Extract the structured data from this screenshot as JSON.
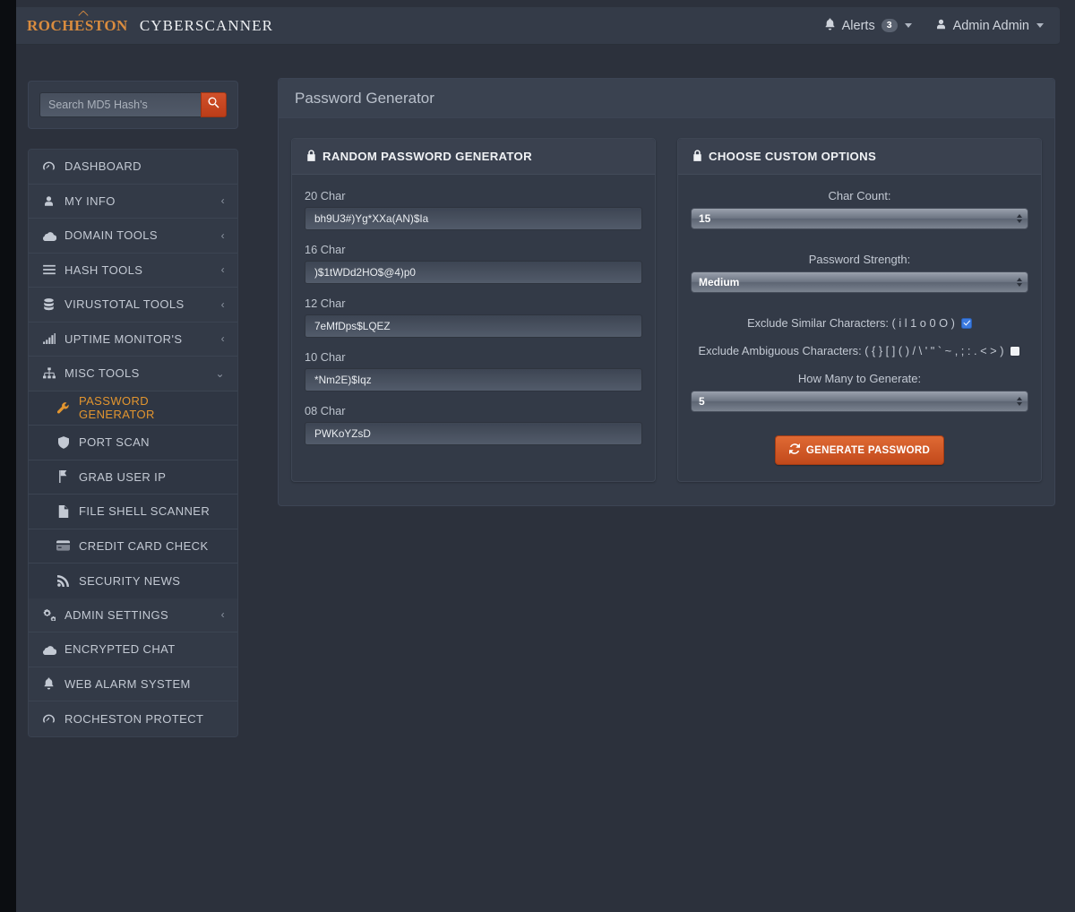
{
  "brand": {
    "primary": "ROCHESTON",
    "secondary": "CYBERSCANNER",
    "accent": "#d98c3f"
  },
  "navbar": {
    "alerts_label": "Alerts",
    "alerts_count": "3",
    "user_label": "Admin Admin"
  },
  "search": {
    "placeholder": "Search MD5 Hash's",
    "value": ""
  },
  "sidebar": {
    "items": [
      {
        "label": "DASHBOARD",
        "icon": "dashboard-icon",
        "chevron": ""
      },
      {
        "label": "MY INFO",
        "icon": "user-icon",
        "chevron": "‹"
      },
      {
        "label": "DOMAIN TOOLS",
        "icon": "cloud-icon",
        "chevron": "‹"
      },
      {
        "label": "HASH TOOLS",
        "icon": "bars-icon",
        "chevron": "‹"
      },
      {
        "label": "VIRUSTOTAL TOOLS",
        "icon": "database-icon",
        "chevron": "‹"
      },
      {
        "label": "UPTIME MONITOR'S",
        "icon": "signal-icon",
        "chevron": "‹"
      },
      {
        "label": "MISC TOOLS",
        "icon": "sitemap-icon",
        "chevron": "⌄"
      }
    ],
    "submenu": [
      {
        "label": "PASSWORD GENERATOR",
        "icon": "wrench-icon",
        "active": true
      },
      {
        "label": "PORT SCAN",
        "icon": "shield-icon",
        "active": false
      },
      {
        "label": "GRAB USER IP",
        "icon": "flag-icon",
        "active": false
      },
      {
        "label": "FILE SHELL SCANNER",
        "icon": "file-icon",
        "active": false
      },
      {
        "label": "CREDIT CARD CHECK",
        "icon": "credit-card-icon",
        "active": false
      },
      {
        "label": "SECURITY NEWS",
        "icon": "rss-icon",
        "active": false
      }
    ],
    "footer_items": [
      {
        "label": "ADMIN SETTINGS",
        "icon": "gears-icon",
        "chevron": "‹"
      },
      {
        "label": "ENCRYPTED CHAT",
        "icon": "cloud-icon",
        "chevron": ""
      },
      {
        "label": "WEB ALARM SYSTEM",
        "icon": "bell-icon",
        "chevron": ""
      },
      {
        "label": "ROCHESTON PROTECT",
        "icon": "dashboard-icon",
        "chevron": ""
      }
    ]
  },
  "main": {
    "page_title": "Password Generator",
    "left_card": {
      "title": "RANDOM PASSWORD GENERATOR",
      "icon": "lock-icon",
      "fields": [
        {
          "label": "20 Char",
          "value": "bh9U3#)Yg*XXa(AN)$Ia"
        },
        {
          "label": "16 Char",
          "value": ")$1tWDd2HO$@4)p0"
        },
        {
          "label": "12 Char",
          "value": "7eMfDps$LQEZ"
        },
        {
          "label": "10 Char",
          "value": "*Nm2E)$Iqz"
        },
        {
          "label": "08 Char",
          "value": "PWKoYZsD"
        }
      ]
    },
    "right_card": {
      "title": "CHOOSE CUSTOM OPTIONS",
      "icon": "lock-icon",
      "char_count": {
        "label": "Char Count:",
        "value": "15"
      },
      "strength": {
        "label": "Password Strength:",
        "value": "Medium"
      },
      "exclude_similar": {
        "label": "Exclude Similar Characters: ( i l 1 o 0 O )",
        "checked": true
      },
      "exclude_ambiguous": {
        "label": "Exclude Ambiguous Characters: ( { } [ ] ( ) / \\ ' \" ` ~ , ; : . < > )",
        "checked": false
      },
      "how_many": {
        "label": "How Many to Generate:",
        "value": "5"
      },
      "generate_button": {
        "label": "GENERATE PASSWORD",
        "icon": "refresh-icon",
        "color": "#c2491b"
      }
    }
  }
}
